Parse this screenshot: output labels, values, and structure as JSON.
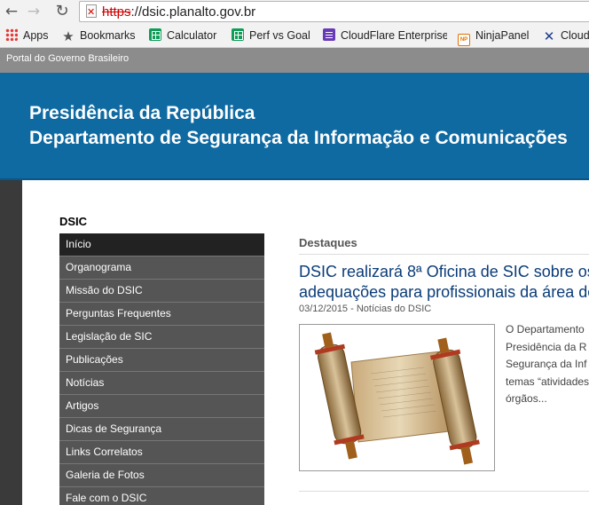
{
  "browser": {
    "url_scheme": "https",
    "url_rest": "://dsic.planalto.gov.br",
    "bookmarks": [
      "Apps",
      "Bookmarks",
      "Calculator",
      "Perf vs Goal",
      "CloudFlare Enterprise",
      "NinjaPanel",
      "Cloudi"
    ]
  },
  "govbar": {
    "label": "Portal do Governo Brasileiro"
  },
  "header": {
    "line1": "Presidência da República",
    "line2": "Departamento de Segurança da Informação e Comunicações"
  },
  "sidebar": {
    "title": "DSIC",
    "items": [
      "Início",
      "Organograma",
      "Missão do DSIC",
      "Perguntas Frequentes",
      "Legislação de SIC",
      "Publicações",
      "Notícias",
      "Artigos",
      "Dicas de Segurança",
      "Links Correlatos",
      "Galeria de Fotos",
      "Fale com o DSIC"
    ]
  },
  "main": {
    "section_title": "Destaques",
    "headline_line1": "DSIC realizará 8ª Oficina de SIC sobre os",
    "headline_line2": "adequações para profissionais da área de",
    "meta": "03/12/2015 - Notícias do DSIC",
    "excerpt": [
      "O Departamento",
      "Presidência da R",
      "Segurança da Inf",
      "temas “atividades",
      "órgãos..."
    ]
  },
  "colors": {
    "header_blue": "#0f6aa2",
    "menu_gray": "#555555",
    "menu_active": "#222222",
    "headline_blue": "#0a3c78"
  }
}
